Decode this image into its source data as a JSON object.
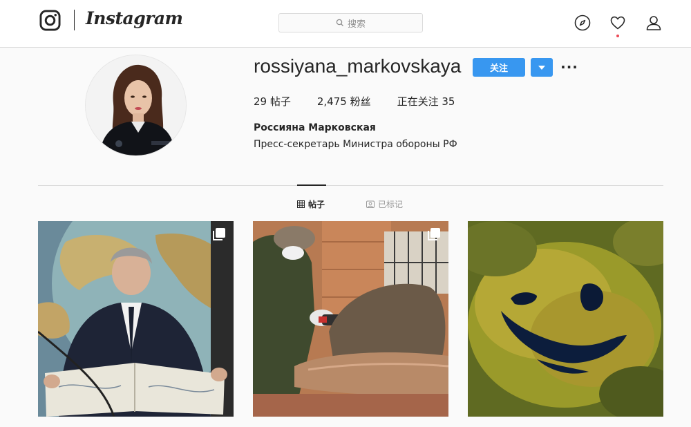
{
  "nav": {
    "brand": "Instagram",
    "search_placeholder": "搜索",
    "icons": [
      "instagram-glyph-icon",
      "search-icon",
      "compass-icon",
      "heart-icon",
      "person-icon"
    ],
    "notification_dot_color": "#ed4956"
  },
  "profile": {
    "username": "rossiyana_markovskaya",
    "follow_label": "关注",
    "more_label": "···",
    "stats": {
      "posts": "29 帖子",
      "followers": "2,475 粉丝",
      "following": "正在关注 35"
    },
    "full_name": "Россияна Марковская",
    "bio": "Пресс-секретарь Министра обороны РФ"
  },
  "tabs": {
    "posts": "帖子",
    "tagged": "已标记",
    "active": "posts"
  },
  "posts": [
    {
      "multi": true
    },
    {
      "multi": true
    },
    {
      "multi": false
    }
  ],
  "colors": {
    "accent": "#3897f0",
    "text": "#262626",
    "muted": "#8e8e8e",
    "border": "#dbdbdb",
    "background": "#fafafa"
  }
}
